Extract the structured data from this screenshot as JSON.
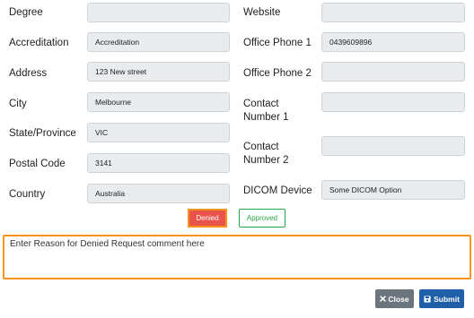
{
  "left_fields": [
    {
      "label": "Degree",
      "value": ""
    },
    {
      "label": "Accreditation",
      "value": "Accreditation"
    },
    {
      "label": "Address",
      "value": "123 New street"
    },
    {
      "label": "City",
      "value": "Melbourne"
    },
    {
      "label": "State/Province",
      "value": "VIC"
    },
    {
      "label": "Postal Code",
      "value": "3141"
    },
    {
      "label": "Country",
      "value": "Australia"
    }
  ],
  "right_fields": [
    {
      "label": "Website",
      "value": ""
    },
    {
      "label": "Office Phone 1",
      "value": "0439609896"
    },
    {
      "label": "Office Phone 2",
      "value": ""
    },
    {
      "label_line1": "Contact",
      "label_line2": "Number 1",
      "value": ""
    },
    {
      "label_line1": "Contact",
      "label_line2": "Number 2",
      "value": ""
    },
    {
      "label": "DICOM Device",
      "value": "Some DICOM Option"
    }
  ],
  "status_buttons": {
    "denied": "Denied",
    "approved": "Approved"
  },
  "comment": {
    "value": "Enter Reason for Denied Request comment here"
  },
  "actions": {
    "close": "Close",
    "submit": "Submit"
  },
  "icons": {
    "close": "times-icon",
    "submit": "floppy-disk-icon"
  },
  "colors": {
    "denied": "#e9534b",
    "approved": "#28a745",
    "highlight": "#f7931e",
    "submit": "#1e5fa8",
    "close": "#6c757d"
  }
}
